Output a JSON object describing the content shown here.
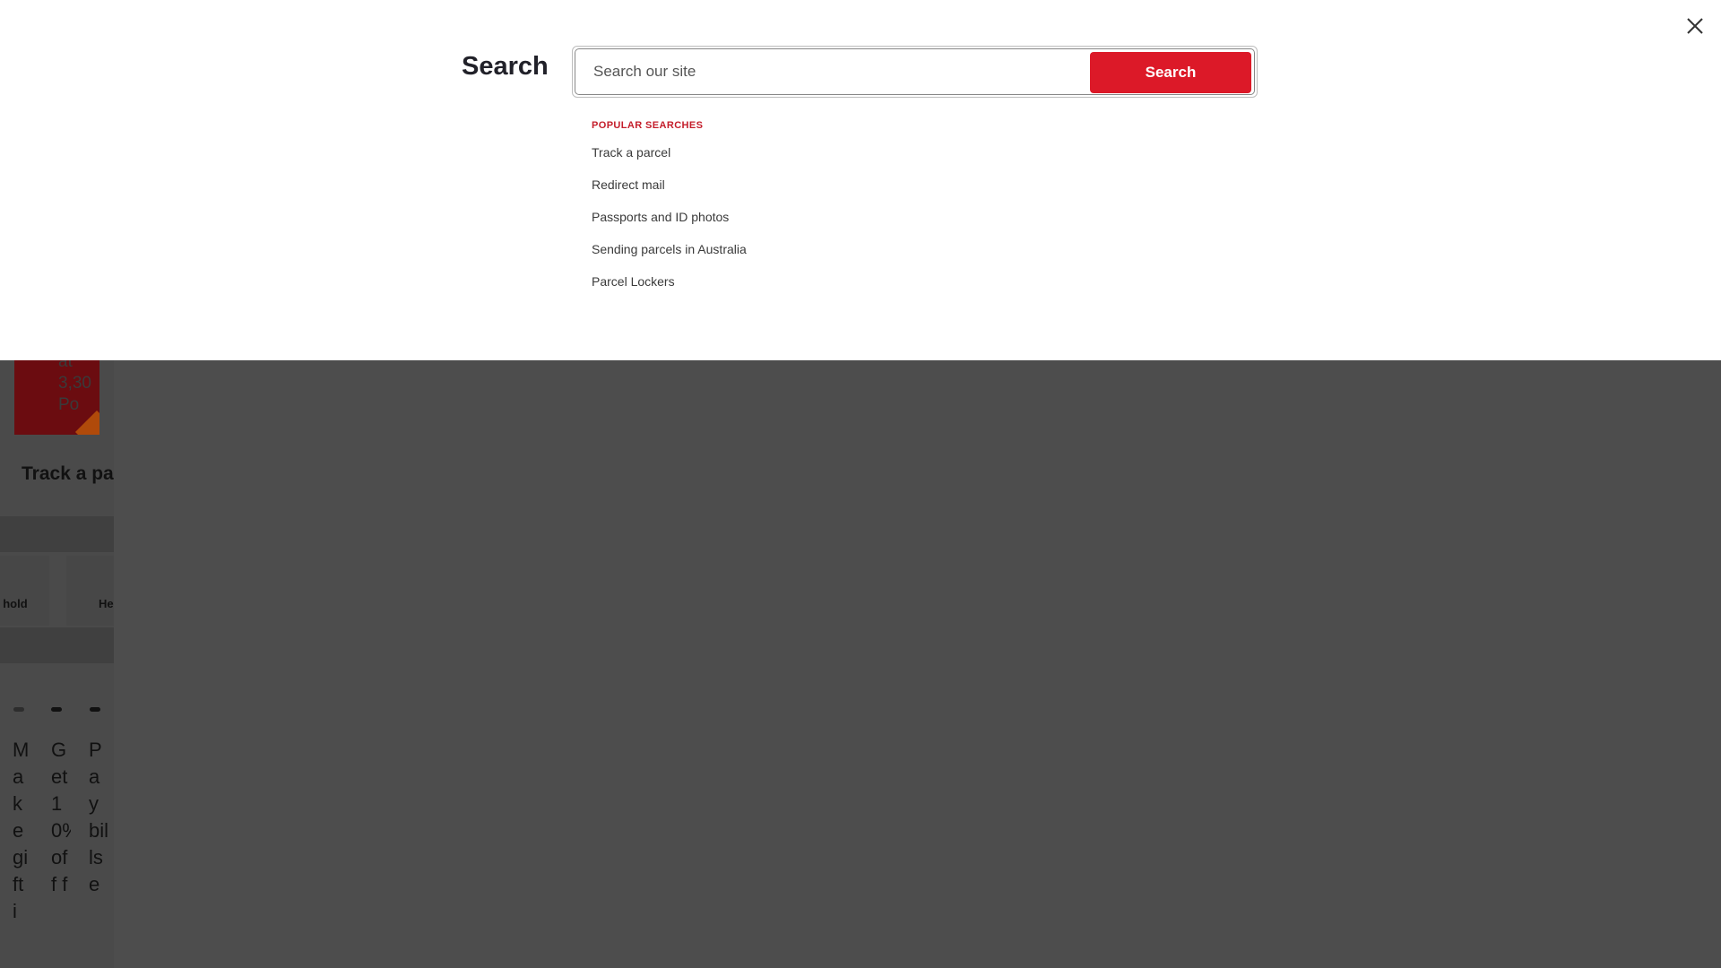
{
  "background": {
    "promo_text": "at\n3,30\nPo",
    "track_heading": "Track a pa",
    "tiles": [
      "l hold",
      "He"
    ],
    "feature_columns": [
      "Make gift i",
      "Get 10% off f",
      "Pay bills e"
    ]
  },
  "search": {
    "title": "Search",
    "placeholder": "Search our site",
    "button_label": "Search",
    "popular_heading": "POPULAR SEARCHES",
    "popular_items": [
      "Track a parcel",
      "Redirect mail",
      "Passports and ID photos",
      "Sending parcels in Australia",
      "Parcel Lockers"
    ]
  },
  "colors": {
    "accent": "#dc1928",
    "popular_heading": "#c41e2b",
    "overlay": "#4d4d4d"
  },
  "icons": {
    "close": "close-icon"
  }
}
